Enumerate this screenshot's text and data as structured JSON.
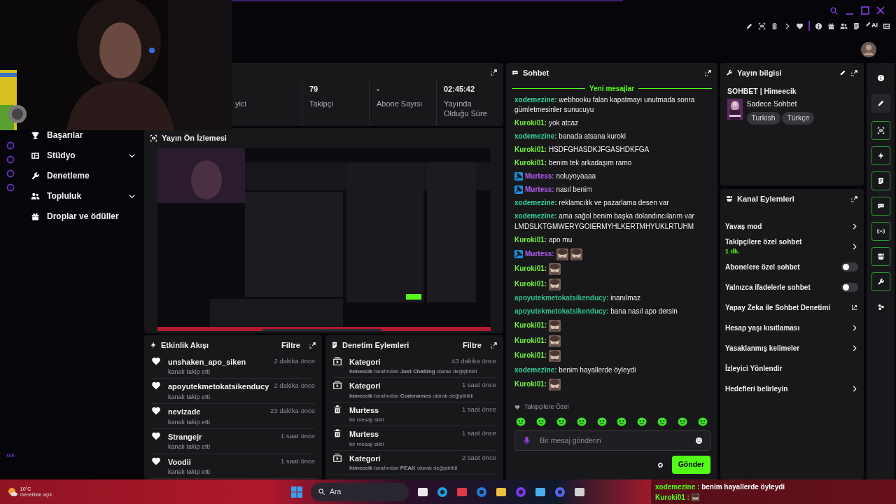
{
  "browser_toolbar": {
    "ai_label": "AI"
  },
  "opera_sidebar": {
    "logo": "GX"
  },
  "nav": [
    {
      "label": "Başarılar",
      "expandable": false
    },
    {
      "label": "Stüdyo",
      "expandable": true
    },
    {
      "label": "Denetleme",
      "expandable": false
    },
    {
      "label": "Topluluk",
      "expandable": true
    },
    {
      "label": "Droplar ve ödüller",
      "expandable": false
    }
  ],
  "stats": [
    {
      "label": "yici"
    },
    {
      "value": "79",
      "label": "Takipçi"
    },
    {
      "value": "-",
      "label": "Abone Sayısı"
    },
    {
      "value": "02:45:42",
      "label": "Yayında Olduğu Süre"
    }
  ],
  "preview": {
    "title": "Yayın Ön İzlemesi"
  },
  "activity": {
    "title": "Etkinlik Akışı",
    "filter": "Filtre",
    "items": [
      {
        "user": "unshaken_apo_siken",
        "action": "kanalı takip etti",
        "time": "2 dakika önce"
      },
      {
        "user": "apoyutekmetokatsikenducy",
        "action": "kanalı takip etti",
        "time": "2 dakika önce"
      },
      {
        "user": "nevizade",
        "action": "kanalı takip etti",
        "time": "23 dakika önce"
      },
      {
        "user": "Strangejr",
        "action": "kanalı takip etti",
        "time": "1 saat önce"
      },
      {
        "user": "Voodii",
        "action": "kanalı takip etti",
        "time": "1 saat önce"
      }
    ]
  },
  "moderation": {
    "title": "Denetim Eylemleri",
    "filter": "Filtre",
    "items": [
      {
        "kind": "category",
        "title": "Kategori",
        "time": "43 dakika önce",
        "detail": "**himeecik** tarafından **Just Chatting** olarak değiştirildi"
      },
      {
        "kind": "category",
        "title": "Kategori",
        "time": "1 saat önce",
        "detail": "**himeecik** tarafından **Codenames** olarak değiştirildi"
      },
      {
        "kind": "delete",
        "title": "Murtess",
        "time": "1 saat önce",
        "detail": "bir mesajı sildi"
      },
      {
        "kind": "delete",
        "title": "Murtess",
        "time": "1 saat önce",
        "detail": "bir mesajı sildi"
      },
      {
        "kind": "category",
        "title": "Kategori",
        "time": "2 saat önce",
        "detail": "**himeecik** tarafından **PEAK** olarak değiştirildi"
      }
    ]
  },
  "chat": {
    "title": "Sohbet",
    "divider": "Yeni mesajlar",
    "messages": [
      {
        "user": "xodemezine:",
        "color": "#3ad29f",
        "moderator": false,
        "text": "webhooku falan kapatmayı unutmada sonra gümletmesinler sunucuyu"
      },
      {
        "user": "Kuroki01:",
        "color": "#72f03c",
        "moderator": false,
        "text": "yok atcaz"
      },
      {
        "user": "xodemezine:",
        "color": "#3ad29f",
        "moderator": false,
        "text": "banada atsana kuroki"
      },
      {
        "user": "Kuroki01:",
        "color": "#72f03c",
        "moderator": false,
        "text": "HSDFGHASDKJFGASHDKFGA"
      },
      {
        "user": "Kuroki01:",
        "color": "#72f03c",
        "moderator": false,
        "text": "benim tek arkadaşım ramo"
      },
      {
        "user": "Murtess:",
        "color": "#b65cf2",
        "moderator": true,
        "text": "noluyoyaaaa"
      },
      {
        "user": "Murtess:",
        "color": "#b65cf2",
        "moderator": true,
        "text": "nasıl benim"
      },
      {
        "user": "xodemezine:",
        "color": "#3ad29f",
        "moderator": false,
        "text": "reklamcılık ve pazarlama desen var"
      },
      {
        "user": "xodemezine:",
        "color": "#3ad29f",
        "moderator": false,
        "text": "ama sağol benim başka dolandıncılarım var LMDSLKTGMWERYGOIERMYHLKERTMHYUKLRTUHM"
      },
      {
        "user": "Kuroki01:",
        "color": "#72f03c",
        "moderator": false,
        "text": "apo mu"
      },
      {
        "user": "Murtess:",
        "color": "#b65cf2",
        "moderator": true
      },
      {
        "user": "Kuroki01:",
        "color": "#72f03c",
        "moderator": false
      },
      {
        "user": "Kuroki01:",
        "color": "#72f03c",
        "moderator": false
      },
      {
        "user": "apoyutekmetokatsikenducy:",
        "color": "#2fbf8c",
        "moderator": false,
        "text": "inanılmaz"
      },
      {
        "user": "apoyutekmetokatsikenducy:",
        "color": "#2fbf8c",
        "moderator": false,
        "text": "bana nasıl apo dersin"
      },
      {
        "user": "Kuroki01:",
        "color": "#72f03c",
        "moderator": false
      },
      {
        "user": "Kuroki01:",
        "color": "#72f03c",
        "moderator": false
      },
      {
        "user": "Kuroki01:",
        "color": "#72f03c",
        "moderator": false
      },
      {
        "user": "xodemezine:",
        "color": "#3ad29f",
        "moderator": false,
        "text": "benim hayallerde öyleydi"
      },
      {
        "user": "Kuroki01:",
        "color": "#72f03c",
        "moderator": false
      }
    ],
    "emote_section": "Takipçilere Özel",
    "placeholder": "Bir mesaj gönderin",
    "send": "Gönder"
  },
  "stream_info": {
    "title": "Yayın bilgisi",
    "stream_title": "SOHBET | Himeecik",
    "category": "Sadece Sohbet",
    "tags": [
      "Turkish",
      "Türkçe"
    ]
  },
  "channel_actions": {
    "title": "Kanal Eylemleri",
    "items": [
      {
        "kind": "chevron",
        "label": "Yavaş mod"
      },
      {
        "kind": "chevron",
        "label": "Takipçilere özel sohbet",
        "sub": "1 dk."
      },
      {
        "kind": "toggle",
        "label": "Abonelere özel sohbet",
        "on": false
      },
      {
        "kind": "toggle",
        "label": "Yalnızca ifadelerle sohbet",
        "on": false
      },
      {
        "kind": "external",
        "label": "Yapay Zeka ile Sohbet Denetimi"
      },
      {
        "kind": "chevron",
        "label": "Hesap yaşı kısıtlaması"
      },
      {
        "kind": "chevron",
        "label": "Yasaklanmış kelimeler"
      },
      {
        "kind": "plain",
        "label": "İzleyici Yönlendir"
      },
      {
        "kind": "chevron",
        "label": "Hedefleri belirleyin"
      }
    ]
  },
  "right_rail": [
    {
      "kind": "info",
      "on": false
    },
    {
      "kind": "pencil",
      "on": false
    },
    {
      "kind": "camera",
      "on": true
    },
    {
      "kind": "bolt",
      "on": true
    },
    {
      "kind": "note",
      "on": true
    },
    {
      "kind": "chat",
      "on": true
    },
    {
      "kind": "broadcast",
      "on": true
    },
    {
      "kind": "actions",
      "on": true
    },
    {
      "kind": "wrench",
      "on": true
    },
    {
      "kind": "dots",
      "on": false
    }
  ],
  "taskbar": {
    "temperature": "10°C",
    "weather": "Genellikle açık",
    "search": "Ara"
  },
  "stream_overlay": [
    {
      "user": "xodemezine :",
      "text": "benim hayallerde öyleydi"
    },
    {
      "user": "Kuroki01 :"
    }
  ]
}
